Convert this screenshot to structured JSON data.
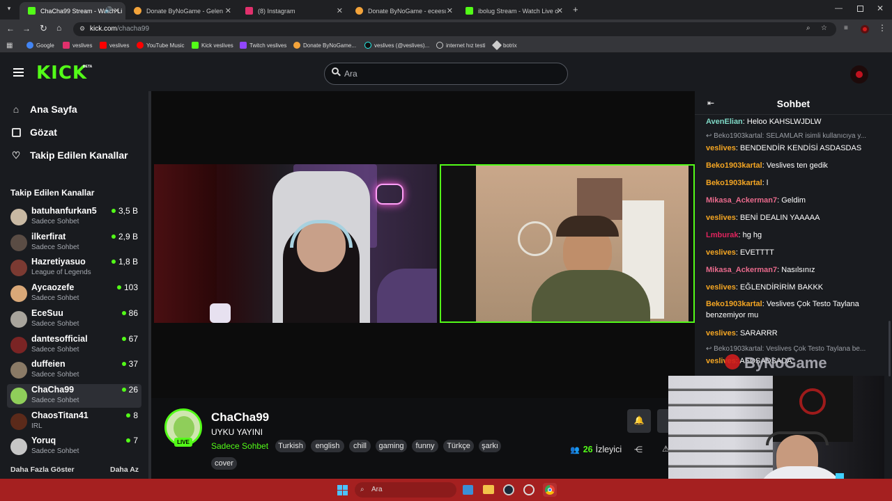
{
  "browser": {
    "tabs": [
      {
        "title": "ChaCha99 Stream - Watch Li",
        "color": "#53fc18"
      },
      {
        "title": "Donate ByNoGame - Gelen/Gi",
        "color": "#f3a33a"
      },
      {
        "title": "(8) Instagram",
        "color": "#e1306c"
      },
      {
        "title": "Donate ByNoGame - eceesu De",
        "color": "#f3a33a"
      },
      {
        "title": "ibolug Stream - Watch Live on",
        "color": "#53fc18"
      }
    ],
    "url_domain": "kick.com",
    "url_path": "/chacha99",
    "bookmarks": [
      "Google",
      "veslives",
      "veslives",
      "YouTube Music",
      "Kick veslives",
      "Twitch veslives",
      "Donate ByNoGame...",
      "veslives (@veslives)...",
      "internet hız testi",
      "botrix"
    ]
  },
  "header": {
    "logo_text": "KICK",
    "beta": "BETA",
    "search_placeholder": "Ara"
  },
  "sidebar": {
    "nav": [
      {
        "label": "Ana Sayfa",
        "icon": "home-icon"
      },
      {
        "label": "Gözat",
        "icon": "browse-icon"
      },
      {
        "label": "Takip Edilen Kanallar",
        "icon": "heart-icon"
      }
    ],
    "section_title": "Takip Edilen Kanallar",
    "channels": [
      {
        "name": "batuhanfurkan5",
        "sub": "Sadece Sohbet",
        "viewers": "3,5 B",
        "avatar": "#c9b9a3"
      },
      {
        "name": "ilkerfirat",
        "sub": "Sadece Sohbet",
        "viewers": "2,9 B",
        "avatar": "#5a4c44"
      },
      {
        "name": "Hazretiyasuo",
        "sub": "League of Legends",
        "viewers": "1,8 B",
        "avatar": "#7b3a32"
      },
      {
        "name": "Aycaozefe",
        "sub": "Sadece Sohbet",
        "viewers": "103",
        "avatar": "#d9a878"
      },
      {
        "name": "EceSuu",
        "sub": "Sadece Sohbet",
        "viewers": "86",
        "avatar": "#a8a49c"
      },
      {
        "name": "dantesofficial",
        "sub": "Sadece Sohbet",
        "viewers": "67",
        "avatar": "#7a2424"
      },
      {
        "name": "duffeien",
        "sub": "Sadece Sohbet",
        "viewers": "37",
        "avatar": "#8a7a66"
      },
      {
        "name": "ChaCha99",
        "sub": "Sadece Sohbet",
        "viewers": "26",
        "avatar": "#8fce5a"
      },
      {
        "name": "ChaosTitan41",
        "sub": "IRL",
        "viewers": "8",
        "avatar": "#5b2a1a"
      },
      {
        "name": "Yoruq",
        "sub": "Sadece Sohbet",
        "viewers": "7",
        "avatar": "#c6c6c6"
      }
    ],
    "show_more": "Daha Fazla Göster",
    "show_less": "Daha Az"
  },
  "stream": {
    "channel_name": "ChaCha99",
    "live_badge": "LIVE",
    "title": "UYKU YAYINI",
    "category": "Sadece Sohbet",
    "tags": [
      "Turkish",
      "english",
      "chill",
      "gaming",
      "funny",
      "Türkçe",
      "şarkı",
      "cover"
    ],
    "viewer_count": "26",
    "viewer_label": "İzleyici"
  },
  "chat": {
    "title": "Sohbet",
    "messages": [
      {
        "user": "AvenElian",
        "color": "#7fd9c6",
        "text": "Heloo KAHSLWJDLW"
      },
      {
        "reply": "Beko1903kartal: SELAMLAR isimli kullanıcıya y..."
      },
      {
        "user": "veslives",
        "color": "#f5a623",
        "text": "BENDENDİR KENDİSİ ASDASDAS"
      },
      {
        "user": "Beko1903kartal",
        "color": "#f5a623",
        "text": "Veslives ten gedik"
      },
      {
        "user": "Beko1903kartal",
        "color": "#f5a623",
        "text": "l"
      },
      {
        "user": "Mikasa_Ackerman7",
        "color": "#e96a8c",
        "text": "Geldim"
      },
      {
        "user": "veslives",
        "color": "#f5a623",
        "text": "BENİ DEALIN YAAAAA"
      },
      {
        "user": "Lmburak",
        "color": "#e0245e",
        "text": "hg hg"
      },
      {
        "user": "veslives",
        "color": "#f5a623",
        "text": "EVETTTT"
      },
      {
        "user": "Mikasa_Ackerman7",
        "color": "#e96a8c",
        "text": "Nasılsınız"
      },
      {
        "user": "veslives",
        "color": "#f5a623",
        "text": "EĞLENDİRİRİM BAKKK"
      },
      {
        "user": "Beko1903kartal",
        "color": "#f5a623",
        "text": "Veslives Çok Testo Taylana benzemiyor mu"
      },
      {
        "user": "veslives",
        "color": "#f5a623",
        "text": "SARARRR"
      },
      {
        "reply": "Beko1903kartal: Veslives Çok Testo Taylana be..."
      },
      {
        "user": "veslives",
        "color": "#f5a623",
        "text": "ASDSADSADA"
      }
    ]
  },
  "overlay": {
    "watermark": "ByNoGame"
  },
  "taskbar": {
    "search_placeholder": "Ara"
  },
  "colors": {
    "accent": "#53fc18",
    "taskbar": "#a52020"
  }
}
